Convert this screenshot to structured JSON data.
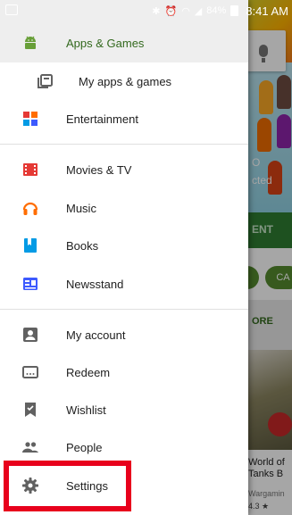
{
  "status_bar": {
    "battery": "84%",
    "time": "8:41 AM"
  },
  "background": {
    "banner_text": [
      "O",
      "cted"
    ],
    "green_bar_text": "ENT",
    "chips": [
      "",
      "CA"
    ],
    "more_label": "ORE",
    "card": {
      "title_line1": "World of",
      "title_line2": "Tanks B",
      "publisher": "Wargamin",
      "rating": "4.3 ★"
    }
  },
  "drawer": {
    "items": [
      {
        "label": "Apps & Games",
        "icon": "android-icon"
      },
      {
        "label": "My apps & games",
        "icon": "library-icon"
      },
      {
        "label": "Entertainment",
        "icon": "entertainment-icon"
      },
      {
        "label": "Movies & TV",
        "icon": "movies-icon"
      },
      {
        "label": "Music",
        "icon": "headphones-icon"
      },
      {
        "label": "Books",
        "icon": "book-icon"
      },
      {
        "label": "Newsstand",
        "icon": "newsstand-icon"
      },
      {
        "label": "My account",
        "icon": "account-icon"
      },
      {
        "label": "Redeem",
        "icon": "redeem-icon"
      },
      {
        "label": "Wishlist",
        "icon": "wishlist-icon"
      },
      {
        "label": "People",
        "icon": "people-icon"
      },
      {
        "label": "Settings",
        "icon": "gear-icon"
      }
    ]
  },
  "colors": {
    "apps_green": "#689f38",
    "movies_red": "#e53935",
    "music_orange": "#ff6d00",
    "books_blue": "#039be5",
    "newsstand_blue": "#3d5afe",
    "highlight_red": "#e8001c"
  }
}
